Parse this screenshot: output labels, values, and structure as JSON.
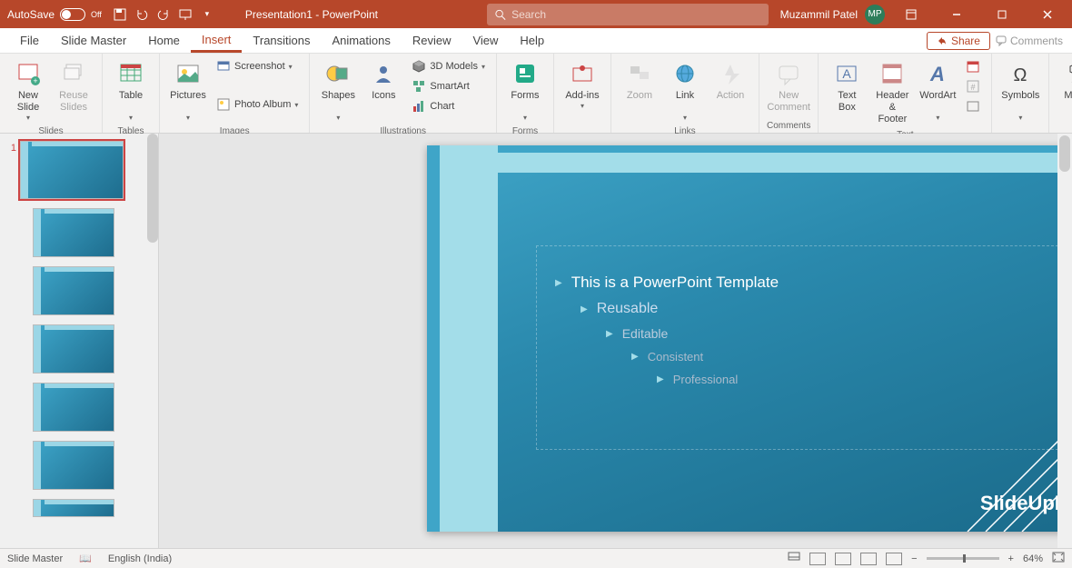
{
  "titlebar": {
    "autosave_label": "AutoSave",
    "autosave_state": "Off",
    "document_title": "Presentation1  -  PowerPoint",
    "search_placeholder": "Search",
    "user_name": "Muzammil Patel",
    "user_initials": "MP"
  },
  "tabs": {
    "items": [
      "File",
      "Slide Master",
      "Home",
      "Insert",
      "Transitions",
      "Animations",
      "Review",
      "View",
      "Help"
    ],
    "active": "Insert",
    "share": "Share",
    "comments": "Comments"
  },
  "ribbon": {
    "groups": {
      "slides": {
        "label": "Slides",
        "new_slide": "New Slide",
        "reuse": "Reuse Slides"
      },
      "tables": {
        "label": "Tables",
        "table": "Table"
      },
      "images": {
        "label": "Images",
        "pictures": "Pictures",
        "screenshot": "Screenshot",
        "album": "Photo Album"
      },
      "illustrations": {
        "label": "Illustrations",
        "shapes": "Shapes",
        "icons": "Icons",
        "models": "3D Models",
        "smartart": "SmartArt",
        "chart": "Chart"
      },
      "forms": {
        "label": "Forms",
        "forms": "Forms"
      },
      "addins": {
        "label": "",
        "addins": "Add-ins"
      },
      "links": {
        "label": "Links",
        "zoom": "Zoom",
        "link": "Link",
        "action": "Action"
      },
      "comments": {
        "label": "Comments",
        "new_comment": "New Comment"
      },
      "text": {
        "label": "Text",
        "textbox": "Text Box",
        "header": "Header & Footer",
        "wordart": "WordArt"
      },
      "symbols": {
        "label": "",
        "symbols": "Symbols"
      },
      "media": {
        "label": "",
        "media": "Media"
      }
    }
  },
  "thumbnails": {
    "selected_number": "1"
  },
  "slide": {
    "bullets": {
      "b1": "This is a PowerPoint Template",
      "b2": "Reusable",
      "b3": "Editable",
      "b4": "Consistent",
      "b5": "Professional"
    },
    "brand": "SlideUpLift"
  },
  "statusbar": {
    "mode": "Slide Master",
    "lang_icon": "",
    "language": "English (India)",
    "zoom": "64%"
  }
}
